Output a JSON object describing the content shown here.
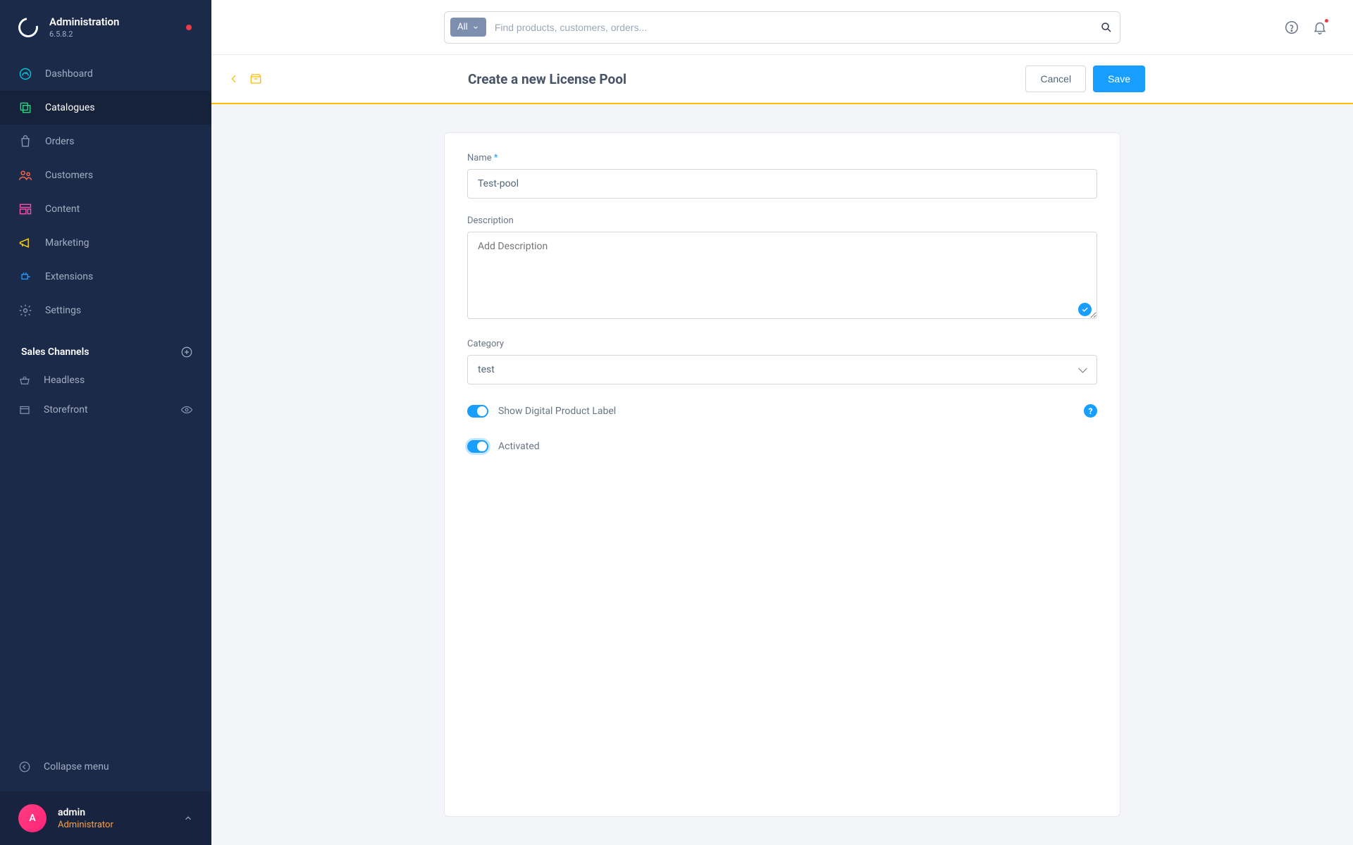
{
  "header": {
    "app_title": "Administration",
    "app_version": "6.5.8.2"
  },
  "sidebar": {
    "items": [
      {
        "label": "Dashboard",
        "icon_color": "#00c8d7"
      },
      {
        "label": "Catalogues",
        "icon_color": "#24d67f"
      },
      {
        "label": "Orders",
        "icon_color": "#8593b5"
      },
      {
        "label": "Customers",
        "icon_color": "#ff6a4d"
      },
      {
        "label": "Content",
        "icon_color": "#ff4da6"
      },
      {
        "label": "Marketing",
        "icon_color": "#ffd500"
      },
      {
        "label": "Extensions",
        "icon_color": "#189eff"
      },
      {
        "label": "Settings",
        "icon_color": "#8593b5"
      }
    ],
    "section_title": "Sales Channels",
    "channels": [
      {
        "label": "Headless"
      },
      {
        "label": "Storefront"
      }
    ],
    "collapse_label": "Collapse menu"
  },
  "user": {
    "avatar_initial": "A",
    "name": "admin",
    "role": "Administrator"
  },
  "search": {
    "scope_label": "All",
    "placeholder": "Find products, customers, orders..."
  },
  "page": {
    "title": "Create a new License Pool",
    "cancel_label": "Cancel",
    "save_label": "Save"
  },
  "form": {
    "name_label": "Name",
    "name_value": "Test-pool",
    "description_label": "Description",
    "description_placeholder": "Add Description",
    "description_value": "",
    "category_label": "Category",
    "category_value": "test",
    "digital_label": "Show Digital Product Label",
    "activated_label": "Activated"
  }
}
